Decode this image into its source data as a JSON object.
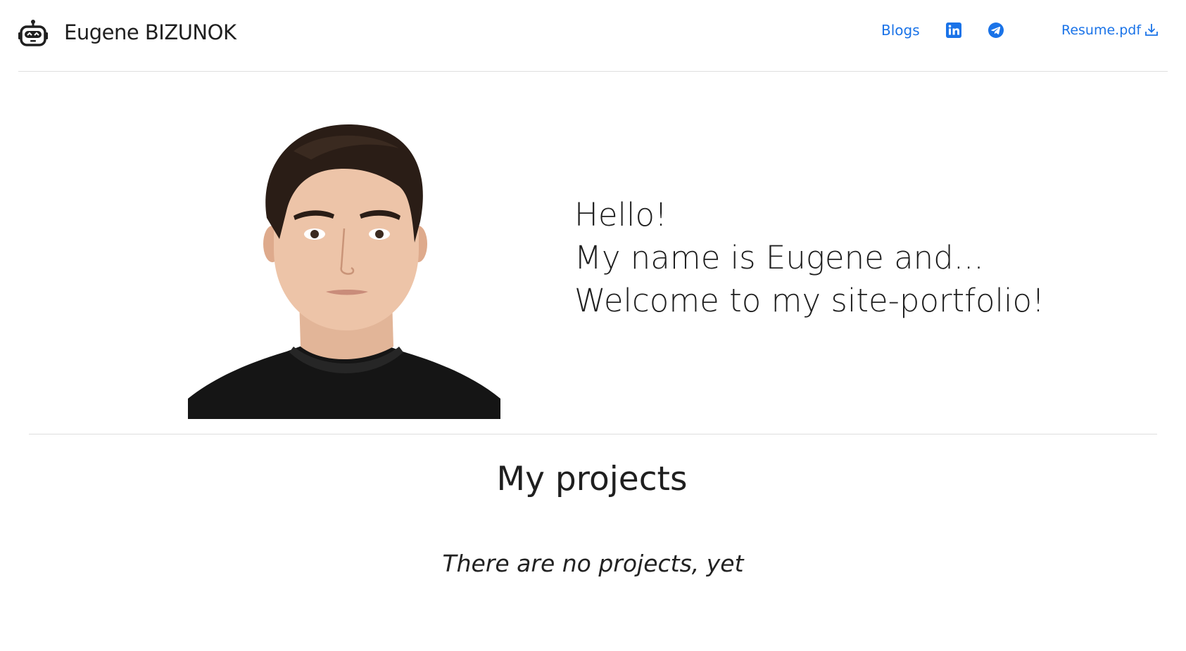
{
  "header": {
    "logo_icon": "robot-icon",
    "brand": "Eugene BIZUNOK",
    "nav": {
      "blogs_label": "Blogs",
      "linkedin_icon": "linkedin-icon",
      "telegram_icon": "telegram-icon",
      "resume_label": "Resume.pdf",
      "resume_icon": "download-icon"
    }
  },
  "hero": {
    "portrait_alt": "Portrait photo",
    "lines": [
      "Hello!",
      "My name is Eugene and...",
      "Welcome to my site-portfolio!"
    ]
  },
  "projects": {
    "title": "My projects",
    "empty_message": "There are no projects, yet"
  },
  "colors": {
    "link": "#1a73e8",
    "text": "#1f1f1f",
    "divider": "#dedede"
  }
}
